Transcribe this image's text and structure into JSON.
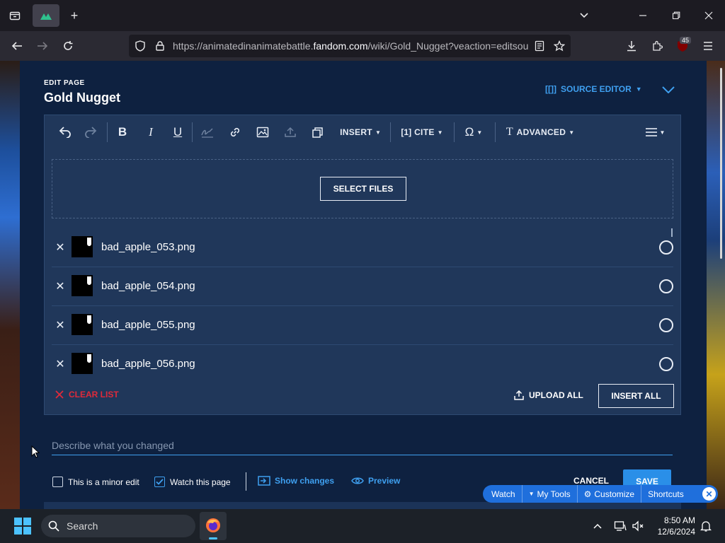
{
  "browser": {
    "url_prefix": "https://animatedinanimatebattle.",
    "url_domain": "fandom.com",
    "url_suffix": "/wiki/Gold_Nugget?veaction=editsou",
    "extensions_badge": "45"
  },
  "editor": {
    "edit_page_label": "EDIT PAGE",
    "page_title": "Gold Nugget",
    "source_editor_label": "SOURCE EDITOR",
    "toolbar": {
      "insert_label": "INSERT",
      "cite_label": "CITE",
      "advanced_label": "ADVANCED"
    },
    "upload": {
      "select_files_label": "SELECT FILES",
      "files": [
        {
          "name": "bad_apple_053.png"
        },
        {
          "name": "bad_apple_054.png"
        },
        {
          "name": "bad_apple_055.png"
        },
        {
          "name": "bad_apple_056.png"
        }
      ],
      "clear_list_label": "CLEAR LIST",
      "upload_all_label": "UPLOAD ALL",
      "insert_all_label": "INSERT ALL"
    },
    "summary_placeholder": "Describe what you changed",
    "minor_edit_label": "This is a minor edit",
    "minor_edit_checked": false,
    "watch_page_label": "Watch this page",
    "watch_page_checked": true,
    "show_changes_label": "Show changes",
    "preview_label": "Preview",
    "cancel_label": "CANCEL",
    "save_label": "SAVE"
  },
  "fandom_toolbar": {
    "watch": "Watch",
    "my_tools": "My Tools",
    "customize": "Customize",
    "shortcuts": "Shortcuts"
  },
  "taskbar": {
    "search_label": "Search",
    "time": "8:50 AM",
    "date": "12/6/2024"
  },
  "colors": {
    "accent": "#3fa0f0",
    "clear_list": "#e02a3a",
    "editor_bg": "#0e2140",
    "dialog_bg": "#20375a",
    "save_bg": "#2a8fe8",
    "fandom_toolbar_bg": "#1f6fdc"
  }
}
